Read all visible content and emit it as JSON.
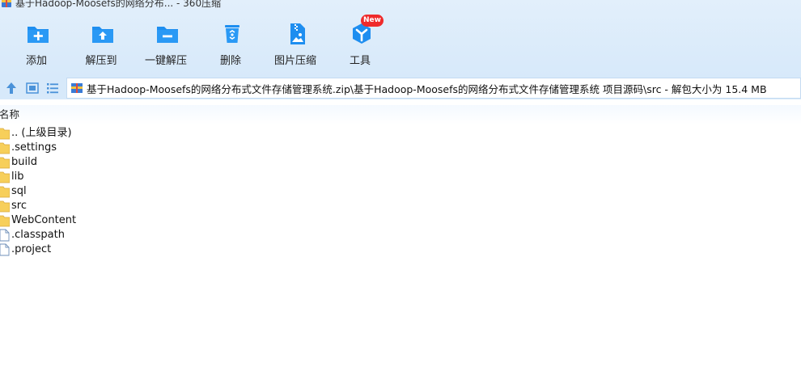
{
  "window": {
    "title": "基于Hadoop-Moosefs的网络分布... - 360压缩"
  },
  "toolbar": {
    "items": [
      {
        "label": "添加",
        "icon": "add-folder-icon"
      },
      {
        "label": "解压到",
        "icon": "extract-to-icon"
      },
      {
        "label": "一键解压",
        "icon": "one-click-extract-icon"
      },
      {
        "label": "删除",
        "icon": "recycle-bin-icon"
      },
      {
        "label": "图片压缩",
        "icon": "image-compress-icon"
      },
      {
        "label": "工具",
        "icon": "tools-icon"
      }
    ],
    "badge": "New"
  },
  "address": {
    "path": "基于Hadoop-Moosefs的网络分布式文件存储管理系统.zip\\基于Hadoop-Moosefs的网络分布式文件存储管理系统 项目源码\\src - 解包大小为 15.4 MB"
  },
  "columns": {
    "name": "名称"
  },
  "files": [
    {
      "name": ".. (上级目录)",
      "type": "folder"
    },
    {
      "name": ".settings",
      "type": "folder"
    },
    {
      "name": "build",
      "type": "folder"
    },
    {
      "name": "lib",
      "type": "folder"
    },
    {
      "name": "sql",
      "type": "folder"
    },
    {
      "name": "src",
      "type": "folder"
    },
    {
      "name": "WebContent",
      "type": "folder"
    },
    {
      "name": ".classpath",
      "type": "file"
    },
    {
      "name": ".project",
      "type": "file"
    }
  ],
  "colors": {
    "accent": "#1e8ef0",
    "folder": "#f7cf5a",
    "toolbar_bg": "#d7e9fa",
    "badge": "#ef2b2b"
  }
}
